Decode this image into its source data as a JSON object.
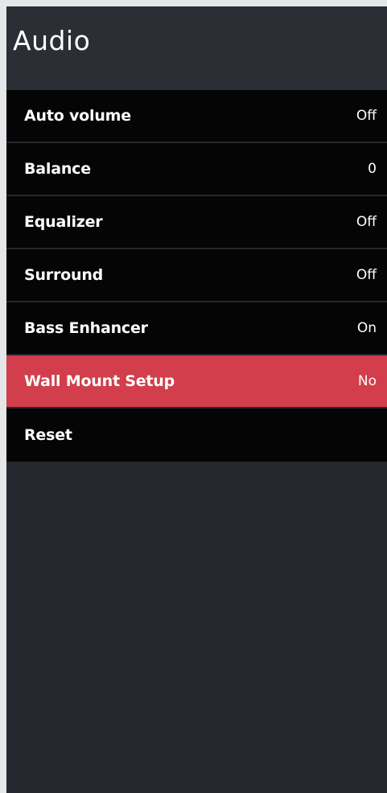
{
  "header": {
    "title": "Audio"
  },
  "menu": {
    "items": [
      {
        "label": "Auto volume",
        "value": "Off"
      },
      {
        "label": "Balance",
        "value": "0"
      },
      {
        "label": "Equalizer",
        "value": "Off"
      },
      {
        "label": "Surround",
        "value": "Off"
      },
      {
        "label": "Bass Enhancer",
        "value": "On"
      },
      {
        "label": "Wall Mount Setup",
        "value": "No",
        "selected": true
      },
      {
        "label": "Reset",
        "value": ""
      }
    ]
  },
  "colors": {
    "page_background": "#e6e7e9",
    "panel_background": "#262830",
    "header_background": "#2c2e36",
    "item_background": "#050505",
    "selected_item_background": "#d23e4b",
    "separator": "#9a9ca3",
    "text": "#ffffff"
  }
}
